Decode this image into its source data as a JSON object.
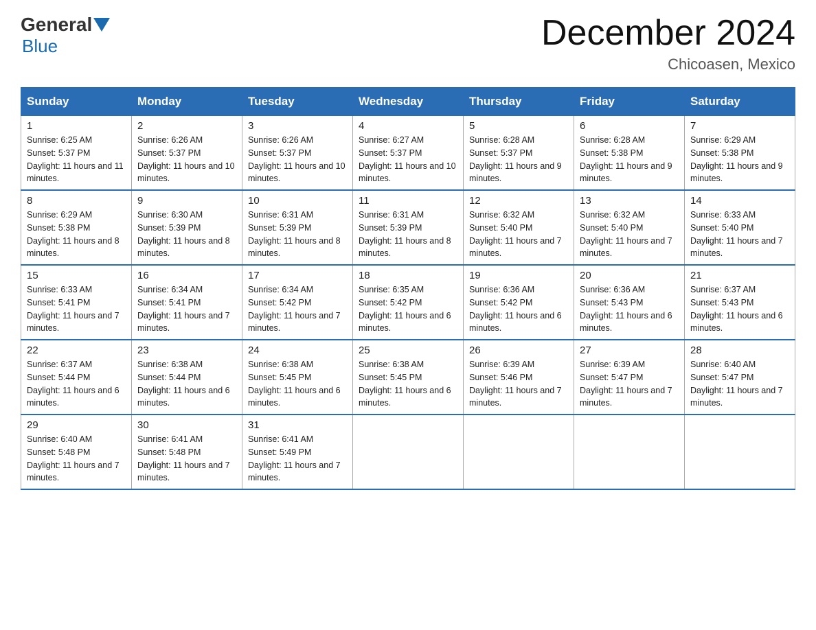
{
  "header": {
    "logo_general": "General",
    "logo_blue": "Blue",
    "title": "December 2024",
    "location": "Chicoasen, Mexico"
  },
  "columns": [
    "Sunday",
    "Monday",
    "Tuesday",
    "Wednesday",
    "Thursday",
    "Friday",
    "Saturday"
  ],
  "weeks": [
    [
      {
        "day": "1",
        "sunrise": "6:25 AM",
        "sunset": "5:37 PM",
        "daylight": "11 hours and 11 minutes."
      },
      {
        "day": "2",
        "sunrise": "6:26 AM",
        "sunset": "5:37 PM",
        "daylight": "11 hours and 10 minutes."
      },
      {
        "day": "3",
        "sunrise": "6:26 AM",
        "sunset": "5:37 PM",
        "daylight": "11 hours and 10 minutes."
      },
      {
        "day": "4",
        "sunrise": "6:27 AM",
        "sunset": "5:37 PM",
        "daylight": "11 hours and 10 minutes."
      },
      {
        "day": "5",
        "sunrise": "6:28 AM",
        "sunset": "5:37 PM",
        "daylight": "11 hours and 9 minutes."
      },
      {
        "day": "6",
        "sunrise": "6:28 AM",
        "sunset": "5:38 PM",
        "daylight": "11 hours and 9 minutes."
      },
      {
        "day": "7",
        "sunrise": "6:29 AM",
        "sunset": "5:38 PM",
        "daylight": "11 hours and 9 minutes."
      }
    ],
    [
      {
        "day": "8",
        "sunrise": "6:29 AM",
        "sunset": "5:38 PM",
        "daylight": "11 hours and 8 minutes."
      },
      {
        "day": "9",
        "sunrise": "6:30 AM",
        "sunset": "5:39 PM",
        "daylight": "11 hours and 8 minutes."
      },
      {
        "day": "10",
        "sunrise": "6:31 AM",
        "sunset": "5:39 PM",
        "daylight": "11 hours and 8 minutes."
      },
      {
        "day": "11",
        "sunrise": "6:31 AM",
        "sunset": "5:39 PM",
        "daylight": "11 hours and 8 minutes."
      },
      {
        "day": "12",
        "sunrise": "6:32 AM",
        "sunset": "5:40 PM",
        "daylight": "11 hours and 7 minutes."
      },
      {
        "day": "13",
        "sunrise": "6:32 AM",
        "sunset": "5:40 PM",
        "daylight": "11 hours and 7 minutes."
      },
      {
        "day": "14",
        "sunrise": "6:33 AM",
        "sunset": "5:40 PM",
        "daylight": "11 hours and 7 minutes."
      }
    ],
    [
      {
        "day": "15",
        "sunrise": "6:33 AM",
        "sunset": "5:41 PM",
        "daylight": "11 hours and 7 minutes."
      },
      {
        "day": "16",
        "sunrise": "6:34 AM",
        "sunset": "5:41 PM",
        "daylight": "11 hours and 7 minutes."
      },
      {
        "day": "17",
        "sunrise": "6:34 AM",
        "sunset": "5:42 PM",
        "daylight": "11 hours and 7 minutes."
      },
      {
        "day": "18",
        "sunrise": "6:35 AM",
        "sunset": "5:42 PM",
        "daylight": "11 hours and 6 minutes."
      },
      {
        "day": "19",
        "sunrise": "6:36 AM",
        "sunset": "5:42 PM",
        "daylight": "11 hours and 6 minutes."
      },
      {
        "day": "20",
        "sunrise": "6:36 AM",
        "sunset": "5:43 PM",
        "daylight": "11 hours and 6 minutes."
      },
      {
        "day": "21",
        "sunrise": "6:37 AM",
        "sunset": "5:43 PM",
        "daylight": "11 hours and 6 minutes."
      }
    ],
    [
      {
        "day": "22",
        "sunrise": "6:37 AM",
        "sunset": "5:44 PM",
        "daylight": "11 hours and 6 minutes."
      },
      {
        "day": "23",
        "sunrise": "6:38 AM",
        "sunset": "5:44 PM",
        "daylight": "11 hours and 6 minutes."
      },
      {
        "day": "24",
        "sunrise": "6:38 AM",
        "sunset": "5:45 PM",
        "daylight": "11 hours and 6 minutes."
      },
      {
        "day": "25",
        "sunrise": "6:38 AM",
        "sunset": "5:45 PM",
        "daylight": "11 hours and 6 minutes."
      },
      {
        "day": "26",
        "sunrise": "6:39 AM",
        "sunset": "5:46 PM",
        "daylight": "11 hours and 7 minutes."
      },
      {
        "day": "27",
        "sunrise": "6:39 AM",
        "sunset": "5:47 PM",
        "daylight": "11 hours and 7 minutes."
      },
      {
        "day": "28",
        "sunrise": "6:40 AM",
        "sunset": "5:47 PM",
        "daylight": "11 hours and 7 minutes."
      }
    ],
    [
      {
        "day": "29",
        "sunrise": "6:40 AM",
        "sunset": "5:48 PM",
        "daylight": "11 hours and 7 minutes."
      },
      {
        "day": "30",
        "sunrise": "6:41 AM",
        "sunset": "5:48 PM",
        "daylight": "11 hours and 7 minutes."
      },
      {
        "day": "31",
        "sunrise": "6:41 AM",
        "sunset": "5:49 PM",
        "daylight": "11 hours and 7 minutes."
      },
      null,
      null,
      null,
      null
    ]
  ]
}
